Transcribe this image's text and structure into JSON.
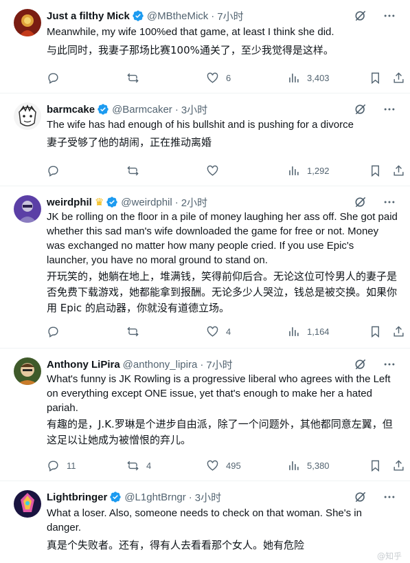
{
  "colors": {
    "verified": "#1d9bf0",
    "muted": "#536471",
    "text": "#0f1419",
    "border": "#eff3f4"
  },
  "tweets": [
    {
      "name": "Just a filthy Mick",
      "handle": "@MBtheMick",
      "time": "7小时",
      "text": "Meanwhile, my wife 100%ed that game, at least I think she did.",
      "translation": "与此同时，我妻子那场比赛100%通关了，至少我觉得是这样。",
      "replies": "",
      "retweets": "",
      "likes": "6",
      "views": "3,403"
    },
    {
      "name": "barmcake",
      "handle": "@Barmcaker",
      "time": "3小时",
      "text": "The wife has had enough of his bullshit and is pushing for a divorce",
      "translation": "妻子受够了他的胡闹，正在推动离婚",
      "replies": "",
      "retweets": "",
      "likes": "",
      "views": "1,292"
    },
    {
      "name": "weirdphil",
      "handle": "@weirdphil",
      "time": "2小时",
      "text": "JK be rolling on the floor in a pile of money laughing her ass off. She got paid whether this sad man's wife downloaded the game for free or not. Money was exchanged no matter how many people cried. If you use Epic's launcher, you have no moral ground to stand on.",
      "translation": "开玩笑的，她躺在地上，堆满钱，笑得前仰后合。无论这位可怜男人的妻子是否免费下载游戏，她都能拿到报酬。无论多少人哭泣，钱总是被交换。如果你用 Epic 的启动器，你就没有道德立场。",
      "replies": "",
      "retweets": "",
      "likes": "4",
      "views": "1,164"
    },
    {
      "name": "Anthony LiPira",
      "handle": "@anthony_lipira",
      "time": "7小时",
      "text": "What's funny is JK Rowling is a progressive liberal who agrees with the Left on everything except ONE issue, yet that's enough to make her a hated pariah.",
      "translation": "有趣的是，J.K.罗琳是个进步自由派，除了一个问题外，其他都同意左翼，但这足以让她成为被憎恨的弃儿。",
      "replies": "11",
      "retweets": "4",
      "likes": "495",
      "views": "5,380"
    },
    {
      "name": "Lightbringer",
      "handle": "@L1ghtBrngr",
      "time": "3小时",
      "text": "What a loser. Also, someone needs to check on that woman. She's in danger.",
      "translation": "真是个失败者。还有，得有人去看看那个女人。她有危险"
    }
  ],
  "separator": "·",
  "watermark": "@知乎"
}
